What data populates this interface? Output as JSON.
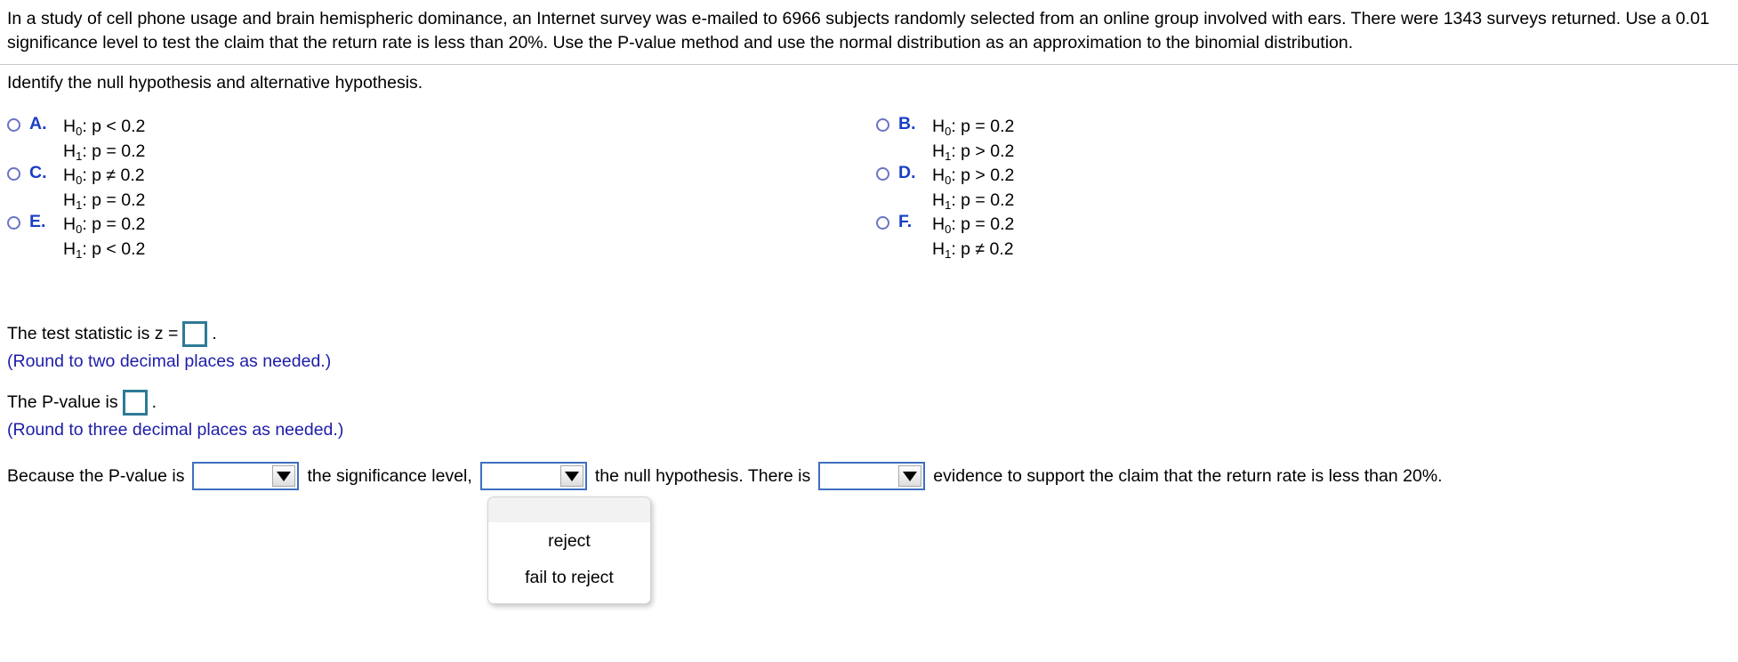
{
  "problem": {
    "statement": "In a study of cell phone usage and brain hemispheric dominance, an Internet survey was e-mailed to 6966 subjects randomly selected from an online group involved with ears. There were 1343 surveys returned. Use a 0.01 significance level to test the claim that the return rate is less than 20%. Use the P-value method and use the normal distribution as an approximation to the binomial distribution.",
    "prompt": "Identify the null hypothesis and alternative hypothesis."
  },
  "options": [
    {
      "letter": "A.",
      "null_label": "H",
      "null_sub": "0",
      "null_expr": ": p < 0.2",
      "alt_label": "H",
      "alt_sub": "1",
      "alt_expr": ": p = 0.2"
    },
    {
      "letter": "B.",
      "null_label": "H",
      "null_sub": "0",
      "null_expr": ": p = 0.2",
      "alt_label": "H",
      "alt_sub": "1",
      "alt_expr": ": p > 0.2"
    },
    {
      "letter": "C.",
      "null_label": "H",
      "null_sub": "0",
      "null_expr": ": p ≠ 0.2",
      "alt_label": "H",
      "alt_sub": "1",
      "alt_expr": ": p = 0.2"
    },
    {
      "letter": "D.",
      "null_label": "H",
      "null_sub": "0",
      "null_expr": ": p > 0.2",
      "alt_label": "H",
      "alt_sub": "1",
      "alt_expr": ": p = 0.2"
    },
    {
      "letter": "E.",
      "null_label": "H",
      "null_sub": "0",
      "null_expr": ": p = 0.2",
      "alt_label": "H",
      "alt_sub": "1",
      "alt_expr": ": p < 0.2"
    },
    {
      "letter": "F.",
      "null_label": "H",
      "null_sub": "0",
      "null_expr": ": p = 0.2",
      "alt_label": "H",
      "alt_sub": "1",
      "alt_expr": ": p ≠ 0.2"
    }
  ],
  "test_statistic": {
    "label_before": "The test statistic is z =",
    "value": "",
    "label_after": ".",
    "hint": "(Round to two decimal places as needed.)"
  },
  "p_value": {
    "label_before": "The P-value is",
    "value": "",
    "label_after": ".",
    "hint": "(Round to three decimal places as needed.)"
  },
  "conclusion": {
    "segment_1": "Because the P-value is",
    "select_1_value": "",
    "segment_2": "the significance level,",
    "select_2_value": "",
    "segment_3": "the null hypothesis. There is",
    "select_3_value": "",
    "segment_4": "evidence to support the claim that the return rate is less than 20%."
  },
  "dropdown": {
    "blank_option": "",
    "options": [
      "reject",
      "fail to reject"
    ]
  },
  "colors": {
    "option_letter": "#1a3fc4",
    "radio_border": "#6b73c4",
    "answer_box_border": "#2e7a96",
    "hint_text": "#1d1da8",
    "select_border": "#3f6fc0",
    "divider": "#c8c8d0"
  }
}
